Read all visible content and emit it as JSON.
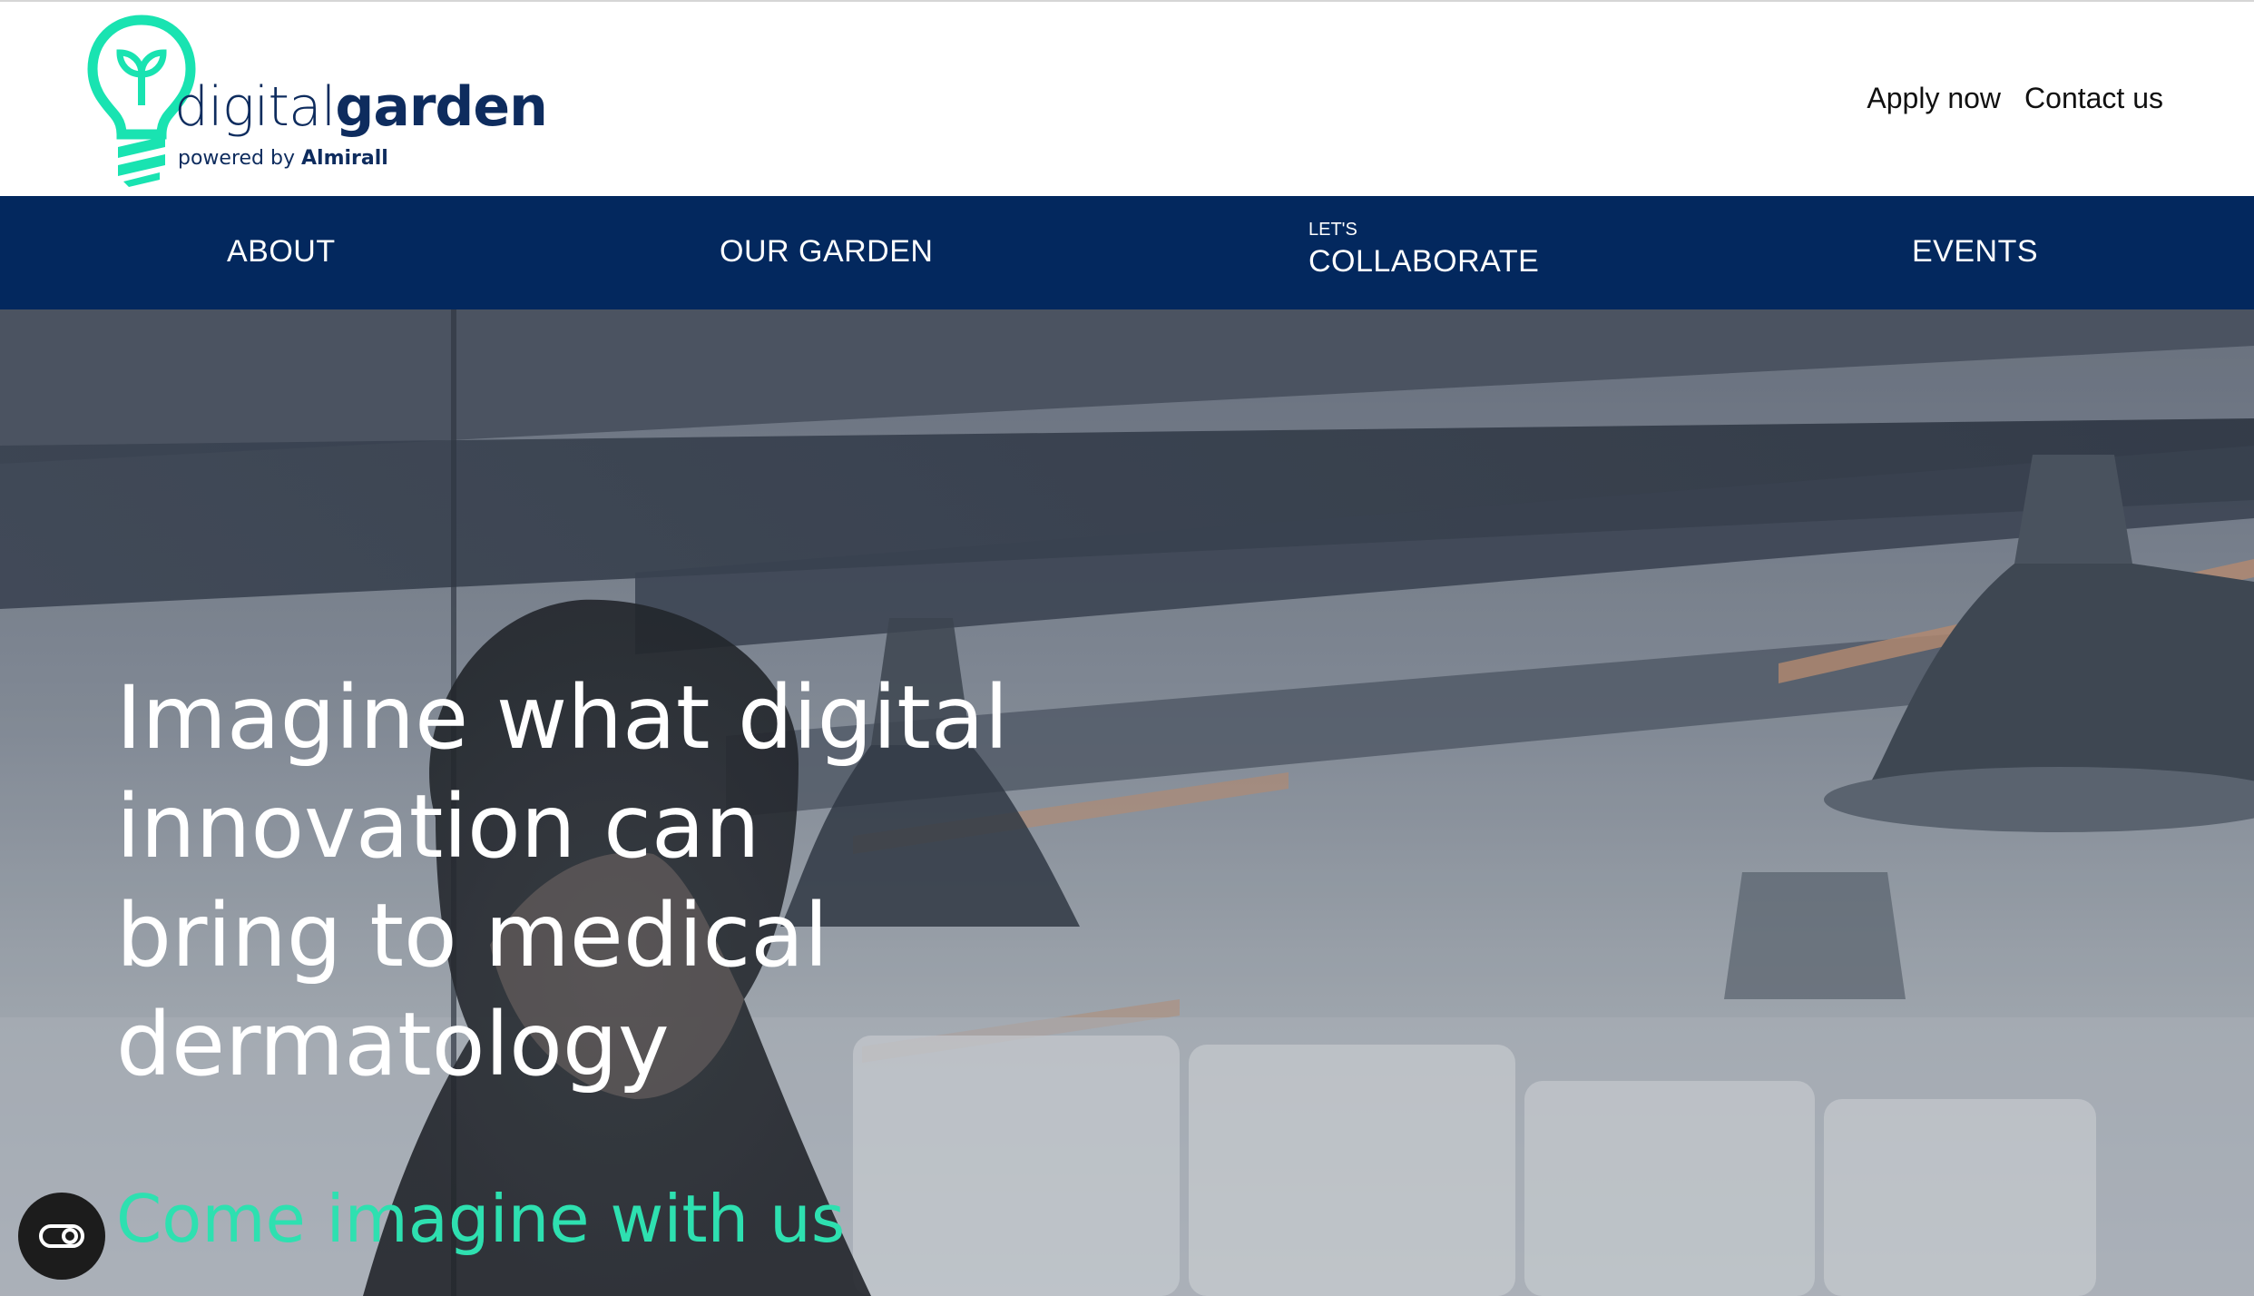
{
  "logo": {
    "word_light": "digital",
    "word_bold": "garden",
    "sub_prefix": "powered by",
    "sub_brand": "Almirall",
    "colors": {
      "bulb": "#19e3b1",
      "text": "#0e2c5e"
    }
  },
  "header": {
    "links": [
      "Apply now",
      "Contact us"
    ]
  },
  "nav": {
    "background": "#03285e",
    "items": [
      {
        "label": "ABOUT"
      },
      {
        "label": "OUR GARDEN"
      },
      {
        "pre": "LET'S",
        "label": "COLLABORATE"
      },
      {
        "label": "EVENTS"
      }
    ]
  },
  "hero": {
    "headline_lines": [
      "Imagine what digital",
      "innovation can",
      "bring to medical",
      "dermatology"
    ],
    "cta": "Come imagine with us",
    "cta_color": "#2ee0b0"
  },
  "accessibility_button": {
    "icon": "accessibility-toggle-icon"
  }
}
